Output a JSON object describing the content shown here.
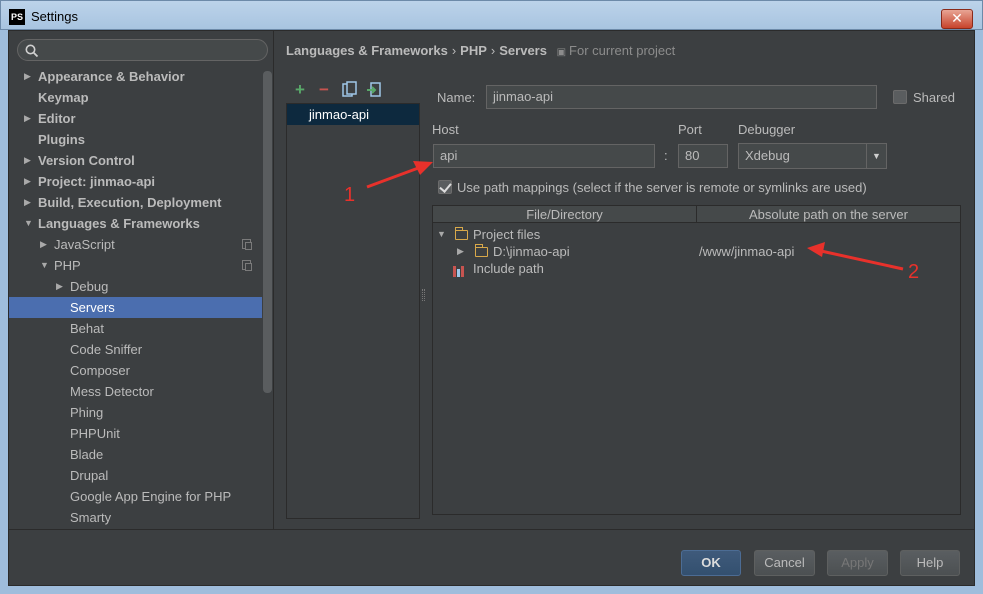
{
  "window": {
    "title": "Settings",
    "app_icon": "PS"
  },
  "search": {
    "placeholder": ""
  },
  "tree": [
    {
      "label": "Appearance & Behavior",
      "level": 0,
      "arrow": "right",
      "bold": true
    },
    {
      "label": "Keymap",
      "level": 0,
      "arrow": "",
      "bold": true
    },
    {
      "label": "Editor",
      "level": 0,
      "arrow": "right",
      "bold": true
    },
    {
      "label": "Plugins",
      "level": 0,
      "arrow": "",
      "bold": true
    },
    {
      "label": "Version Control",
      "level": 0,
      "arrow": "right",
      "bold": true
    },
    {
      "label": "Project: jinmao-api",
      "level": 0,
      "arrow": "right",
      "bold": true
    },
    {
      "label": "Build, Execution, Deployment",
      "level": 0,
      "arrow": "right",
      "bold": true
    },
    {
      "label": "Languages & Frameworks",
      "level": 0,
      "arrow": "down",
      "bold": true
    },
    {
      "label": "JavaScript",
      "level": 1,
      "arrow": "right",
      "badge": true
    },
    {
      "label": "PHP",
      "level": 1,
      "arrow": "down",
      "badge": true
    },
    {
      "label": "Debug",
      "level": 2,
      "arrow": "right"
    },
    {
      "label": "Servers",
      "level": 2,
      "arrow": "",
      "selected": true
    },
    {
      "label": "Behat",
      "level": 2,
      "arrow": ""
    },
    {
      "label": "Code Sniffer",
      "level": 2,
      "arrow": ""
    },
    {
      "label": "Composer",
      "level": 2,
      "arrow": ""
    },
    {
      "label": "Mess Detector",
      "level": 2,
      "arrow": ""
    },
    {
      "label": "Phing",
      "level": 2,
      "arrow": ""
    },
    {
      "label": "PHPUnit",
      "level": 2,
      "arrow": ""
    },
    {
      "label": "Blade",
      "level": 2,
      "arrow": ""
    },
    {
      "label": "Drupal",
      "level": 2,
      "arrow": ""
    },
    {
      "label": "Google App Engine for PHP",
      "level": 2,
      "arrow": ""
    },
    {
      "label": "Smarty",
      "level": 2,
      "arrow": ""
    }
  ],
  "breadcrumb": {
    "parts": [
      "Languages & Frameworks",
      "PHP",
      "Servers"
    ],
    "separator": "›",
    "note": "For current project"
  },
  "servers": {
    "toolbar": {
      "add": "+",
      "remove": "−"
    },
    "items": [
      "jinmao-api"
    ]
  },
  "form": {
    "name_label": "Name:",
    "name_value": "jinmao-api",
    "shared_label": "Shared",
    "shared_checked": false,
    "host_label": "Host",
    "host_value": "api",
    "colon": ":",
    "port_label": "Port",
    "port_value": "80",
    "debugger_label": "Debugger",
    "debugger_value": "Xdebug",
    "use_mappings_label": "Use path mappings (select if the server is remote or symlinks are used)",
    "use_mappings_checked": true
  },
  "mappings": {
    "headers": [
      "File/Directory",
      "Absolute path on the server"
    ],
    "rows": [
      {
        "label": "Project files",
        "target": ""
      },
      {
        "label": "D:\\jinmao-api",
        "target": "/www/jinmao-api"
      },
      {
        "label": "Include path",
        "target": ""
      }
    ]
  },
  "annotations": {
    "one": "1",
    "two": "2"
  },
  "buttons": {
    "ok": "OK",
    "cancel": "Cancel",
    "apply": "Apply",
    "help": "Help"
  },
  "colors": {
    "selection": "#4b6eaf",
    "annotation": "#e8312b",
    "folder": "#d9a94a"
  }
}
